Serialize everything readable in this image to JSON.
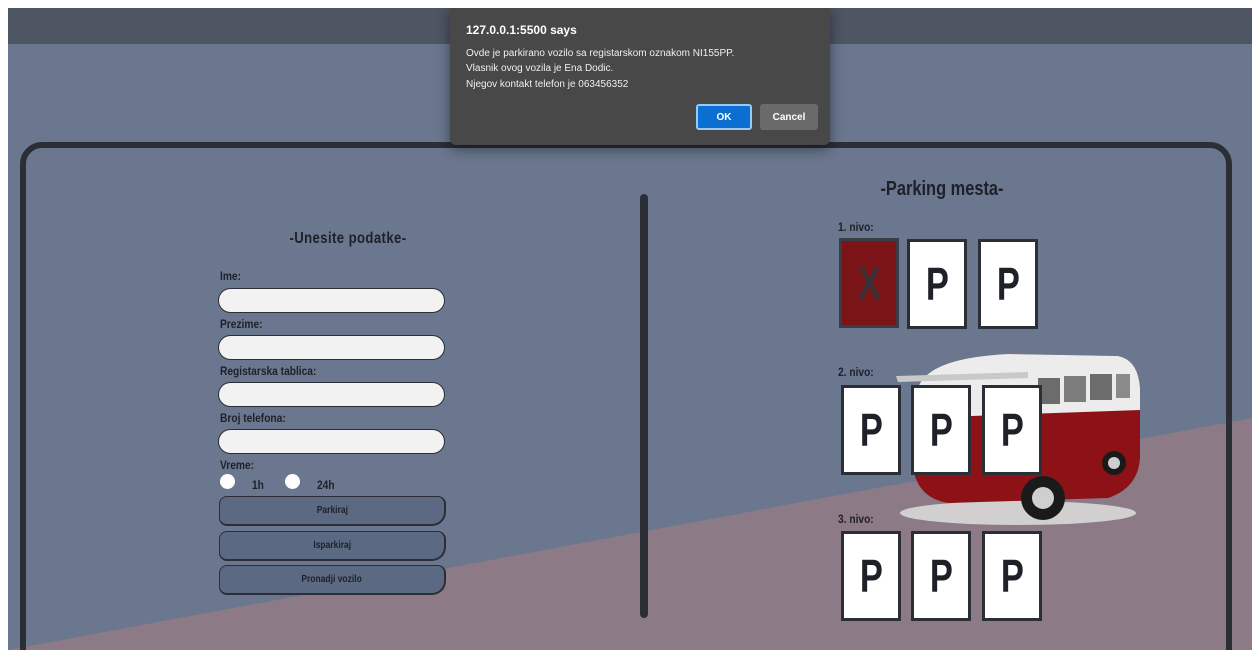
{
  "dialog": {
    "title": "127.0.0.1:5500 says",
    "lines": [
      "Ovde je parkirano vozilo sa registarskom oznakom NI155PP.",
      "Vlasnik ovog vozila je Ena Dodic.",
      "Njegov kontakt telefon je 063456352"
    ],
    "ok_label": "OK",
    "cancel_label": "Cancel"
  },
  "form": {
    "heading": "-Unesite podatke-",
    "fields": [
      {
        "label": "Ime:",
        "value": ""
      },
      {
        "label": "Prezime:",
        "value": ""
      },
      {
        "label": "Registarska tablica:",
        "value": ""
      },
      {
        "label": "Broj telefona:",
        "value": ""
      }
    ],
    "time_label": "Vreme:",
    "time_options": [
      "1h",
      "24h"
    ],
    "buttons": [
      "Parkiraj",
      "Isparkiraj",
      "Pronadji vozilo"
    ]
  },
  "parking": {
    "heading": "-Parking mesta-",
    "levels": [
      {
        "label": "1. nivo:",
        "spots": [
          "X",
          "P",
          "P"
        ]
      },
      {
        "label": "2. nivo:",
        "spots": [
          "P",
          "P",
          "P"
        ]
      },
      {
        "label": "3. nivo:",
        "spots": [
          "P",
          "P",
          "P"
        ]
      }
    ]
  },
  "colors": {
    "background": "#6a778e",
    "header": "#4e5563",
    "stripe": "#8c7a86",
    "frame": "#2b2e35",
    "taken_spot": "#7a1416",
    "ok_button": "#0a6fd1"
  }
}
